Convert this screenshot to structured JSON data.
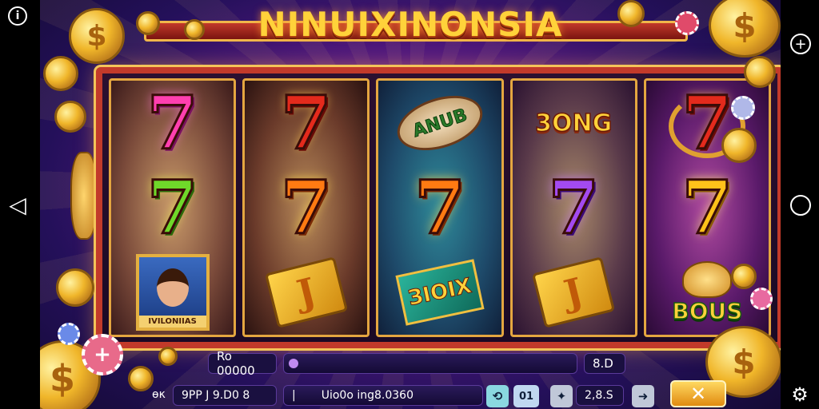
{
  "title": "NINUIXINONSIA",
  "reels": [
    {
      "top": "7",
      "middle": "7",
      "bottom_caption": "IVILONIIAS"
    },
    {
      "top": "7",
      "middle": "7",
      "bottom": "J"
    },
    {
      "top": "ANUB",
      "middle": "7",
      "bottom": "ЗIOIX"
    },
    {
      "top": "3ONG",
      "middle": "7",
      "bottom": "J"
    },
    {
      "top": "7",
      "middle": "7",
      "bottom": "BOUS"
    }
  ],
  "coin_symbol": "$",
  "chip_symbol": "+",
  "hud": {
    "balance_label": "Ro 00000",
    "right_value": "8.D",
    "bet_prefix": "ѳκ",
    "bet_value": "9PP J 9.D0 8",
    "info_separator": "|",
    "info_text": "Uio0o ing8.0360",
    "btn_a": "⟲",
    "btn_b": "01",
    "btn_c": "✦",
    "amount": "2,8.S",
    "btn_arrow": "➜",
    "spin_label": "✕"
  },
  "system": {
    "info": "i",
    "plus": "+",
    "back": "◁",
    "home": "○",
    "settings": "⚙"
  }
}
